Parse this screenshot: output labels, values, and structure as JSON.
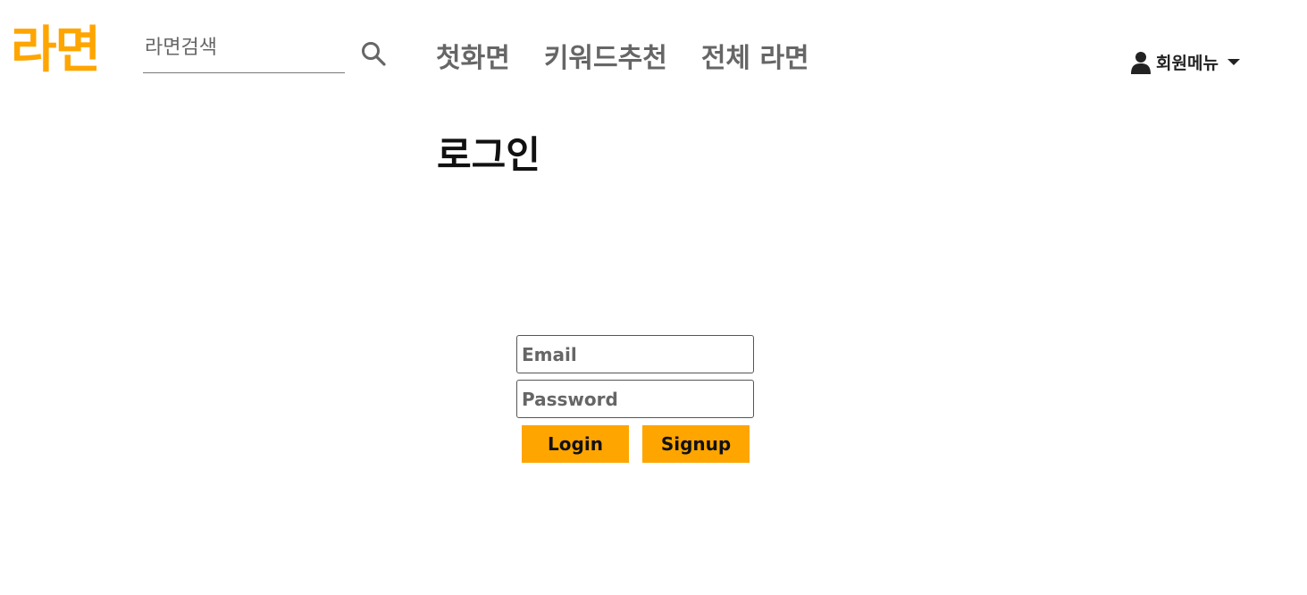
{
  "header": {
    "logo_text": "라면",
    "search": {
      "placeholder": "라면검색",
      "value": "",
      "icon": "search-icon"
    },
    "nav": [
      {
        "label": "첫화면"
      },
      {
        "label": "키워드추천"
      },
      {
        "label": "전체 라면"
      }
    ],
    "member_menu": {
      "label": "회원메뉴",
      "icon": "user-icon"
    }
  },
  "main": {
    "title": "로그인",
    "form": {
      "email_placeholder": "Email",
      "password_placeholder": "Password",
      "login_label": "Login",
      "signup_label": "Signup"
    }
  },
  "colors": {
    "accent": "#ffa500",
    "nav_text": "#666666"
  }
}
